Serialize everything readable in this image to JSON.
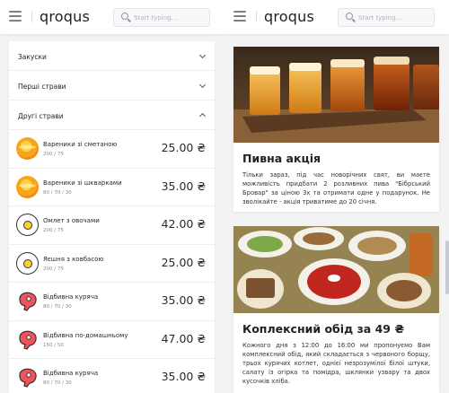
{
  "left": {
    "brand": "qroqus",
    "search": {
      "placeholder": "Start typing..."
    },
    "sections": {
      "snacks": "Закуски",
      "first": "Перші страви",
      "second": "Другі страви"
    },
    "items": [
      {
        "name": "Вареники зі сметаною",
        "weight": "200 / 75",
        "price": "25.00 ₴",
        "icon": "pancake-icon"
      },
      {
        "name": "Вареники зі шкварками",
        "weight": "80 / 70 / 30",
        "price": "35.00 ₴",
        "icon": "pancake-icon"
      },
      {
        "name": "Омлет з овочами",
        "weight": "200 / 75",
        "price": "42.00 ₴",
        "icon": "fried-egg-icon"
      },
      {
        "name": "Яєшня з ковбасою",
        "weight": "200 / 75",
        "price": "25.00 ₴",
        "icon": "fried-egg-icon"
      },
      {
        "name": "Відбивна куряча",
        "weight": "80 / 70 / 30",
        "price": "35.00 ₴",
        "icon": "meat-icon"
      },
      {
        "name": "Відбивна по-домашньому",
        "weight": "150 / 50",
        "price": "47.00 ₴",
        "icon": "meat-icon"
      },
      {
        "name": "Відбивна куряча",
        "weight": "80 / 70 / 30",
        "price": "35.00 ₴",
        "icon": "meat-icon"
      }
    ]
  },
  "right": {
    "brand": "qroqus",
    "search": {
      "placeholder": "Start typing..."
    },
    "posts": [
      {
        "title": "Пивна акція",
        "body": "Тільки зараз, під час новорічних свят, ви маєте можливість придбати 2 розливних пива \"Бібрський Бровар\" за ціною 3х та отримати одне у подарунок. Не зволікайте - акція триватиме до 20 січня."
      },
      {
        "title": "Коплексний обід за 49 ₴",
        "body": "Кожного дня з 12:00 до 16:00 ми пропонуємо Вам комплексний обід, який складається з червоного борщу, трьох курячих котлет, однієї незрозумілої білої штуки, салату із огірка та помідра, шклянки узвару та двох кусочків хліба."
      }
    ]
  },
  "colors": {
    "background": "#f2f3f5",
    "card": "#ffffff",
    "text": "#222222",
    "muted": "#888888"
  }
}
